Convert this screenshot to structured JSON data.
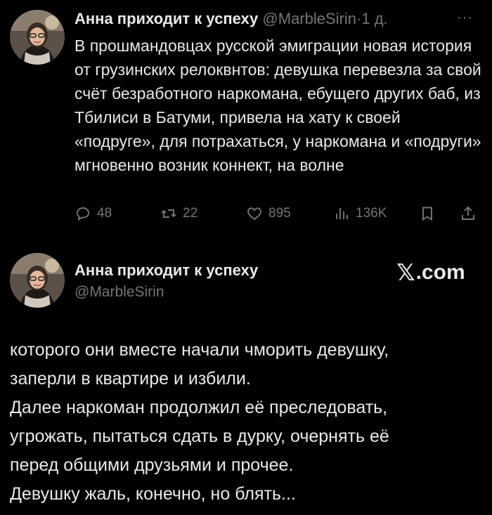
{
  "post1": {
    "author_name": "Анна приходит к успеху",
    "handle": "@MarbleSirin",
    "separator": "·",
    "time": "1 д.",
    "more": "···",
    "text": "В прошмандовцах русской эмиграции новая история от грузинских релоквнтов: девушка перевезла за свой счёт безработного наркомана, ебущего других баб, из Тбилиси в Батуми, привела на хату к своей «подруге», для потрахаться, у наркомана и «подруги» мгновенно возник коннект, на волне",
    "actions": {
      "replies": "48",
      "reposts": "22",
      "likes": "895",
      "views": "136K"
    },
    "icons": [
      "reply-icon",
      "retweet-icon",
      "heart-icon",
      "views-icon",
      "bookmark-icon",
      "share-icon"
    ]
  },
  "post2": {
    "author_name": "Анна приходит к успеху",
    "handle": "@MarbleSirin",
    "brand_x": "𝕏",
    "brand_rest": ".com",
    "lines": [
      "которого они вместе начали чморить девушку,",
      "заперли в квартире и избили.",
      "Далее наркоман продолжил её преследовать,",
      "угрожать, пытаться сдать в дурку, очернять её",
      "перед общими друзьями и прочее.",
      "Девушку жаль, конечно, но блять..."
    ]
  },
  "colors": {
    "background": "#000000",
    "text_primary": "#e7e9ea",
    "text_secondary": "#71767b"
  }
}
